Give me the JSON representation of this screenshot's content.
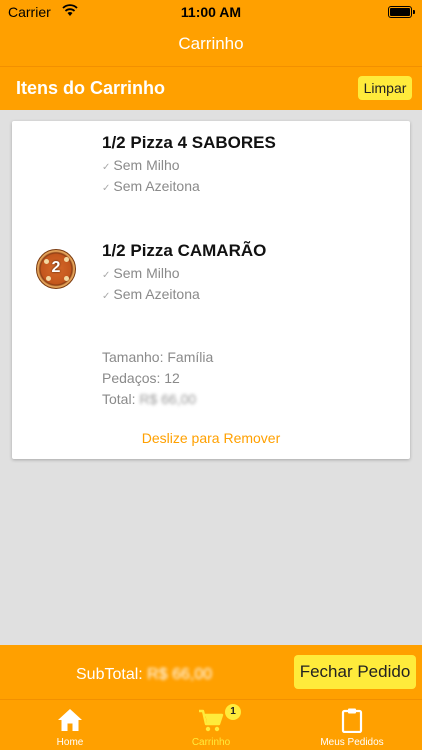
{
  "status": {
    "carrier": "Carrier",
    "time": "11:00 AM"
  },
  "nav": {
    "title": "Carrinho"
  },
  "header": {
    "title": "Itens do Carrinho",
    "clear_label": "Limpar"
  },
  "cart": {
    "items": [
      {
        "name": "1/2 Pizza 4 SABORES",
        "options": [
          "Sem Milho",
          "Sem Azeitona"
        ]
      },
      {
        "name": "1/2 Pizza CAMARÃO",
        "options": [
          "Sem Milho",
          "Sem Azeitona"
        ]
      }
    ],
    "pizza_badge_number": "2",
    "size_label": "Tamanho: Família",
    "slices_label": "Pedaços: 12",
    "total_label": "Total:",
    "total_value": "R$ 66,00",
    "swipe_hint": "Deslize para Remover"
  },
  "footer": {
    "subtotal_label": "SubTotal:",
    "subtotal_value": "R$ 66,00",
    "checkout_label": "Fechar Pedido"
  },
  "tabs": [
    {
      "label": "Home",
      "icon": "home-icon"
    },
    {
      "label": "Carrinho",
      "icon": "cart-icon",
      "badge": "1",
      "active": true
    },
    {
      "label": "Meus Pedidos",
      "icon": "clipboard-icon"
    }
  ],
  "colors": {
    "brand": "#ffa000",
    "button": "#ffeb3b",
    "active_tab": "#ffeb3b",
    "inactive_tab": "#ffffff"
  }
}
